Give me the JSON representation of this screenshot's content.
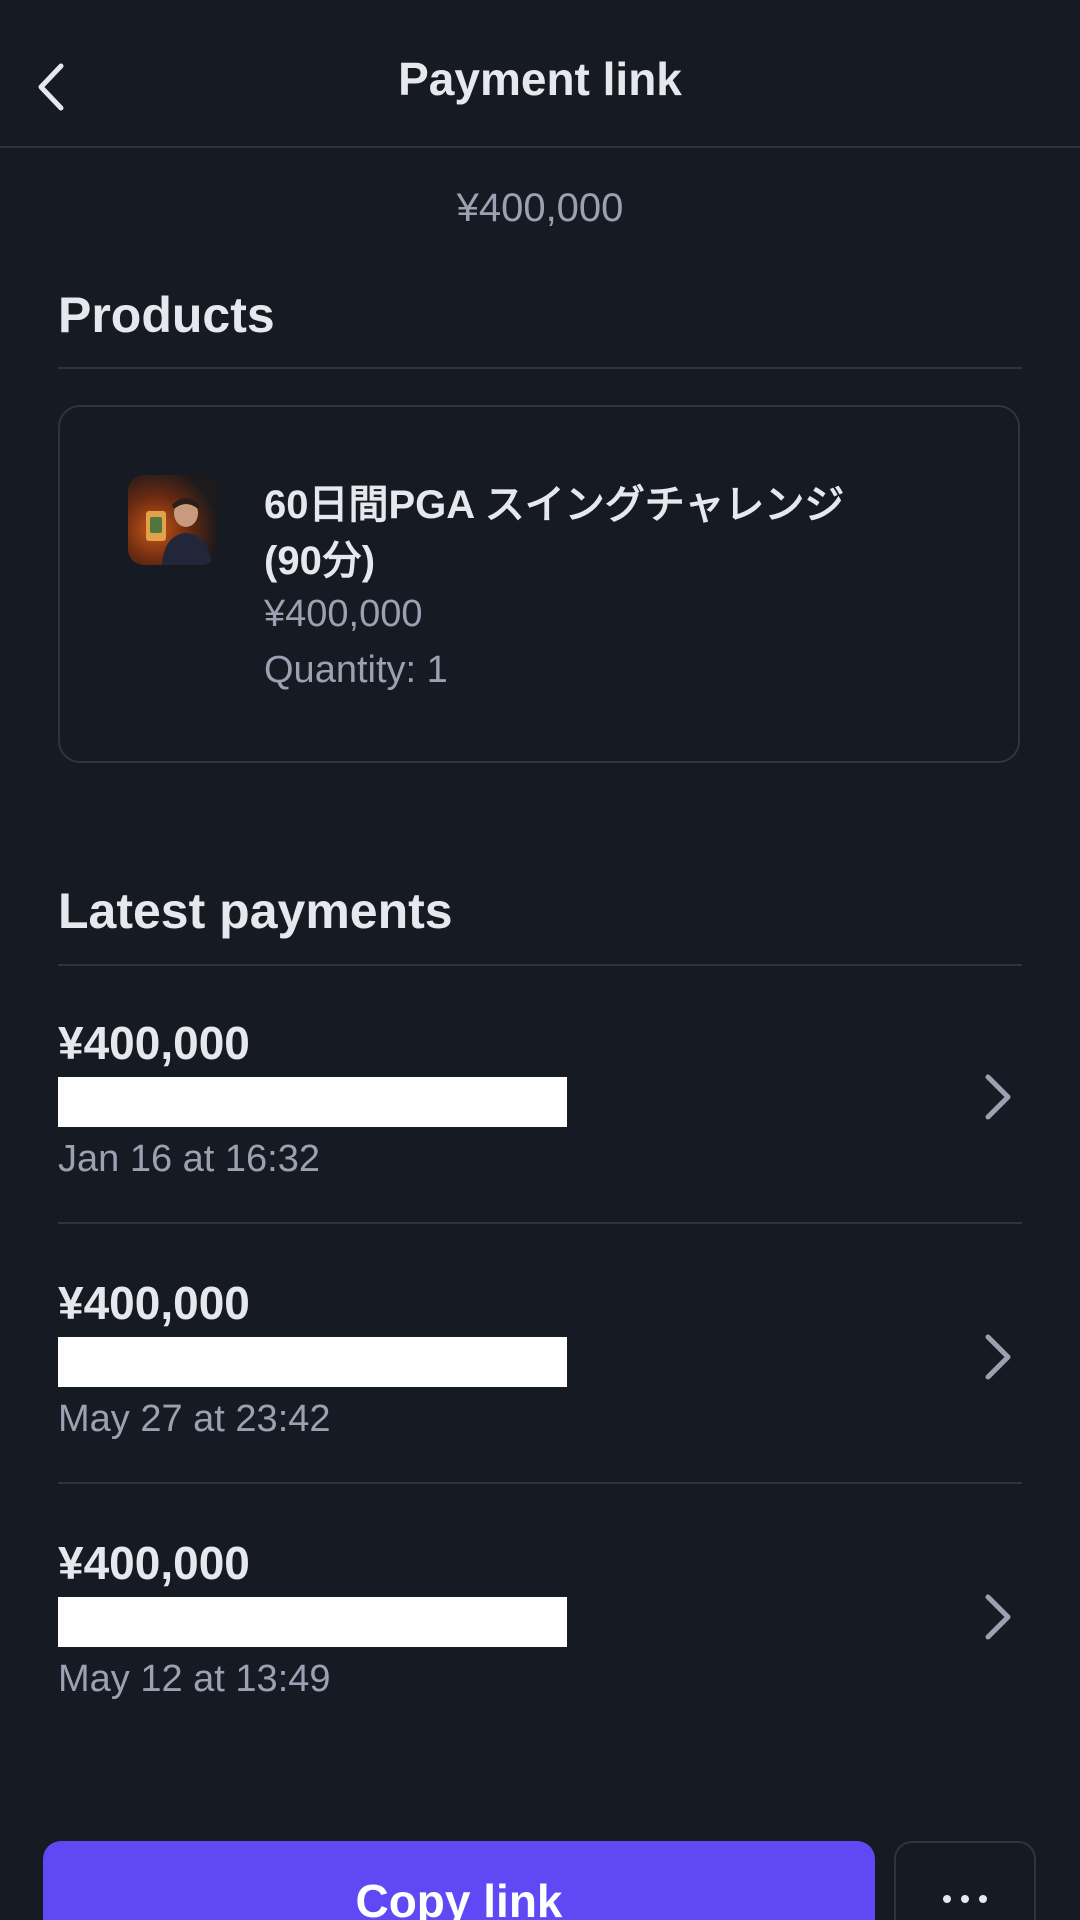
{
  "header": {
    "title": "Payment link",
    "back_icon": "chevron-left-icon"
  },
  "summary": {
    "amount": "¥400,000"
  },
  "products": {
    "title": "Products",
    "items": [
      {
        "name": "60日間PGA スイングチャレンジ (90分)",
        "price": "¥400,000",
        "quantity_label": "Quantity: 1"
      }
    ]
  },
  "payments": {
    "title": "Latest payments",
    "items": [
      {
        "amount": "¥400,000",
        "date": "Jan 16 at 16:32"
      },
      {
        "amount": "¥400,000",
        "date": "May 27 at 23:42"
      },
      {
        "amount": "¥400,000",
        "date": "May 12 at 13:49"
      }
    ]
  },
  "actions": {
    "copy_label": "Copy link",
    "more_icon": "more-horizontal-icon"
  },
  "colors": {
    "background": "#161a22",
    "accent": "#6148f5",
    "divider": "#2f343f",
    "muted_text": "#9aa2b2",
    "text": "#e6e8ee"
  }
}
